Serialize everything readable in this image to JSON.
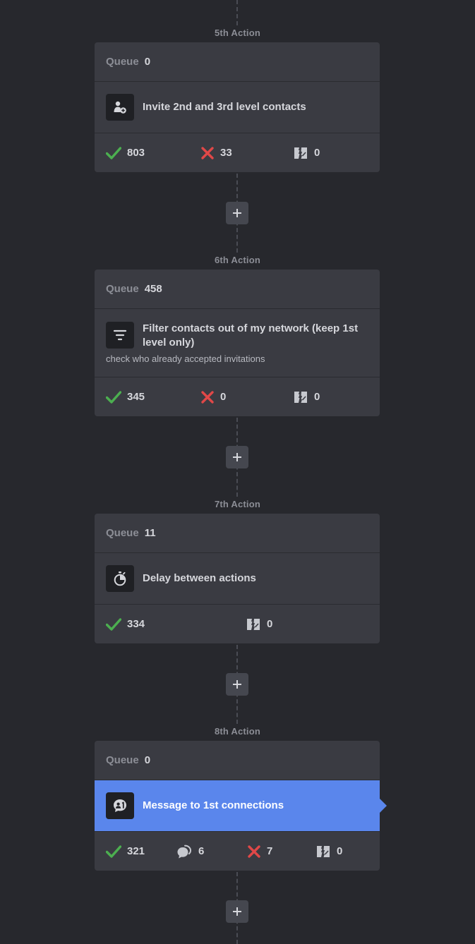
{
  "queue_label": "Queue",
  "actions": [
    {
      "step": "5th Action",
      "queue": "0",
      "icon": "add-user-icon",
      "title": "Invite 2nd and 3rd level contacts",
      "subtitle": "",
      "stats": {
        "success": "803",
        "failed": "33",
        "skipped": "0"
      }
    },
    {
      "step": "6th Action",
      "queue": "458",
      "icon": "filter-icon",
      "title": "Filter contacts out of my network (keep 1st level only)",
      "subtitle": "check who already accepted invitations",
      "stats": {
        "success": "345",
        "failed": "0",
        "skipped": "0"
      }
    },
    {
      "step": "7th Action",
      "queue": "11",
      "icon": "stopwatch-icon",
      "title": "Delay between actions",
      "subtitle": "",
      "stats": {
        "success": "334",
        "skipped": "0"
      }
    },
    {
      "step": "8th Action",
      "queue": "0",
      "icon": "message-contact-icon",
      "title": "Message to 1st connections",
      "subtitle": "",
      "active": true,
      "stats": {
        "success": "321",
        "replied": "6",
        "failed": "7",
        "skipped": "0"
      }
    }
  ],
  "colors": {
    "background": "#27282d",
    "card": "#3a3b42",
    "active": "#5a86ec",
    "success": "#4caf50",
    "failed": "#e04848"
  }
}
